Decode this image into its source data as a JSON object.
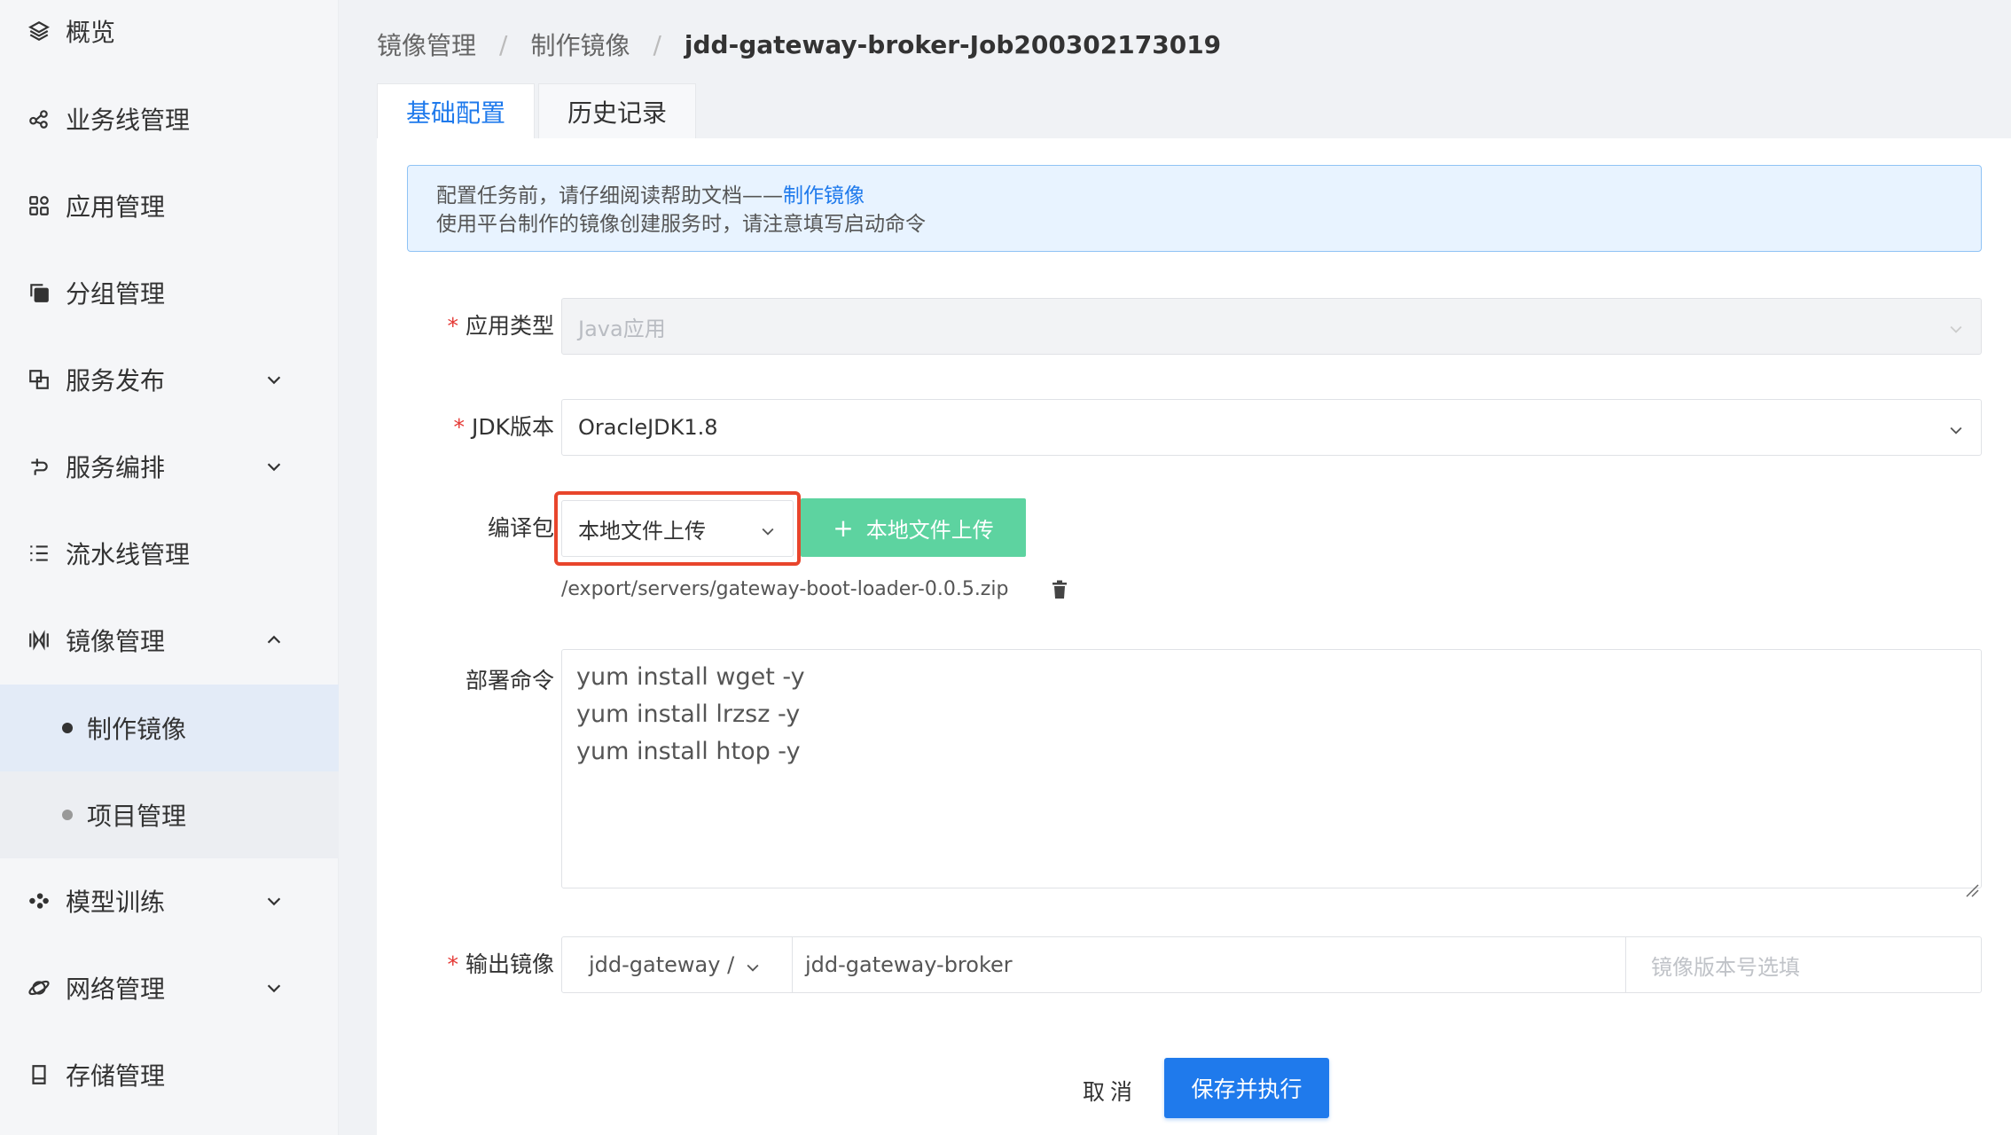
{
  "sidebar": {
    "items": [
      {
        "label": "概览",
        "icon": "layers-icon"
      },
      {
        "label": "业务线管理",
        "icon": "share-icon"
      },
      {
        "label": "应用管理",
        "icon": "apps-icon"
      },
      {
        "label": "分组管理",
        "icon": "copy-icon"
      },
      {
        "label": "服务发布",
        "icon": "publish-icon"
      },
      {
        "label": "服务编排",
        "icon": "orchestrate-icon"
      },
      {
        "label": "流水线管理",
        "icon": "list-icon"
      },
      {
        "label": "镜像管理",
        "icon": "image-icon"
      },
      {
        "label": "模型训练",
        "icon": "model-icon"
      },
      {
        "label": "网络管理",
        "icon": "planet-icon"
      },
      {
        "label": "存储管理",
        "icon": "storage-icon"
      }
    ],
    "submenu": [
      {
        "label": "制作镜像",
        "active": true
      },
      {
        "label": "项目管理",
        "active": false
      }
    ]
  },
  "breadcrumb": {
    "items": [
      "镜像管理",
      "制作镜像",
      "jdd-gateway-broker-Job200302173019"
    ],
    "separator": "/"
  },
  "tabs": [
    {
      "label": "基础配置",
      "active": true
    },
    {
      "label": "历史记录",
      "active": false
    }
  ],
  "alert": {
    "line1_prefix": "配置任务前，请仔细阅读帮助文档——",
    "line1_link": "制作镜像",
    "line2": "使用平台制作的镜像创建服务时，请注意填写启动命令"
  },
  "form": {
    "app_type": {
      "label": "应用类型",
      "required": "*",
      "value": "Java应用"
    },
    "jdk": {
      "label": "JDK版本",
      "required": "*",
      "value": "OracleJDK1.8"
    },
    "package": {
      "label": "编译包",
      "select_value": "本地文件上传",
      "upload_button": "本地文件上传",
      "upload_icon": "+",
      "file_path": "/export/servers/gateway-boot-loader-0.0.5.zip"
    },
    "deploy": {
      "label": "部署命令",
      "lines": [
        "yum install wget -y",
        "yum install lrzsz -y",
        "yum install htop -y"
      ]
    },
    "output": {
      "label": "输出镜像",
      "required": "*",
      "namespace": "jdd-gateway /",
      "name": "jdd-gateway-broker",
      "version_placeholder": "镜像版本号选填"
    }
  },
  "actions": {
    "cancel": "取消",
    "submit": "保存并执行"
  },
  "colors": {
    "primary": "#1f7aec",
    "success": "#5dd3a0",
    "highlight": "#e8452c"
  }
}
